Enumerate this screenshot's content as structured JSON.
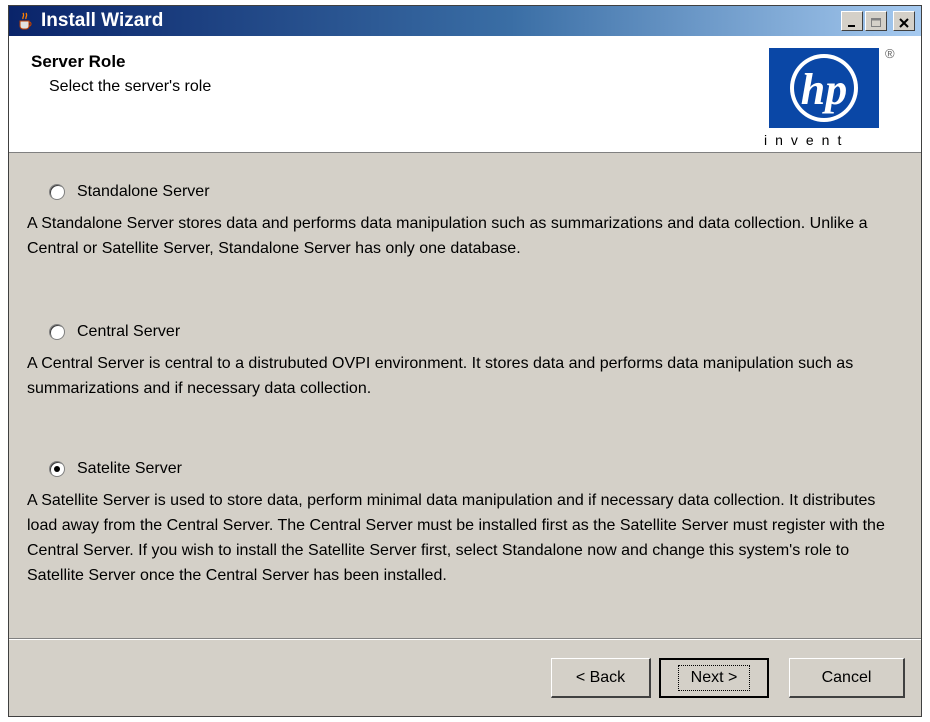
{
  "window": {
    "title": "Install Wizard",
    "controls": {
      "minimize": "_",
      "maximize": "□",
      "close": "X"
    }
  },
  "header": {
    "title": "Server Role",
    "subtitle": "Select the server's role",
    "logo": {
      "mark": "hp",
      "registered": "®",
      "tagline": "invent",
      "color": "#0a47a6"
    }
  },
  "options": [
    {
      "label": "Standalone Server",
      "checked": false,
      "description": "A Standalone Server stores data and performs data manipulation such as summarizations and data collection. Unlike a Central or Satellite Server, Standalone Server has only one database."
    },
    {
      "label": "Central Server",
      "checked": false,
      "description": "A Central Server is central to a distrubuted OVPI environment. It stores data and performs data manipulation such as summarizations and if necessary data collection."
    },
    {
      "label": "Satelite Server",
      "checked": true,
      "description": "A Satellite Server is used to store data, perform minimal data manipulation and if necessary data collection. It distributes load away from the Central Server. The Central Server must be installed first as the Satellite Server must register with the Central Server. If you wish to install the Satellite Server first, select Standalone now and change this system's role to Satellite Server once the Central Server has been installed."
    }
  ],
  "footer": {
    "back_label": "< Back",
    "next_label": "Next >",
    "cancel_label": "Cancel"
  }
}
